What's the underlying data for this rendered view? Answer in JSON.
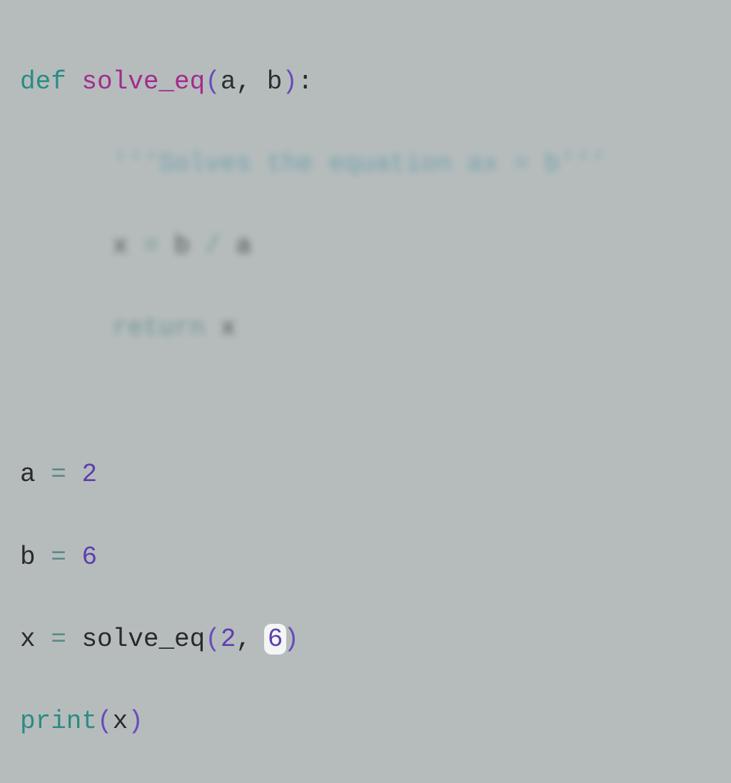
{
  "code": {
    "line1": {
      "def": "def",
      "space1": " ",
      "fn": "solve_eq",
      "lparen": "(",
      "p1": "a",
      "comma": ",",
      "space2": " ",
      "p2": "b",
      "rparen": ")",
      "colon": ":"
    },
    "line2": {
      "indent": "      ",
      "doc": "'''Solves the equation ax = b'''"
    },
    "line3": {
      "indent": "      ",
      "v": "x",
      "sp1": " ",
      "eq": "=",
      "sp2": " ",
      "b": "b",
      "sp3": " ",
      "div": "/",
      "sp4": " ",
      "a": "a"
    },
    "line4": {
      "indent": "      ",
      "ret": "return",
      "sp": " ",
      "x": "x"
    },
    "line6": {
      "a": "a",
      "sp1": " ",
      "eq": "=",
      "sp2": " ",
      "val": "2"
    },
    "line7": {
      "b": "b",
      "sp1": " ",
      "eq": "=",
      "sp2": " ",
      "val": "6"
    },
    "line8": {
      "x": "x",
      "sp1": " ",
      "eq": "=",
      "sp2": " ",
      "fn": "solve_eq",
      "lparen": "(",
      "a1": "2",
      "comma": ",",
      "sp3": " ",
      "a2": "6",
      "rparen": ")"
    },
    "line9": {
      "fn": "print",
      "lparen": "(",
      "arg": "x",
      "rparen": ")"
    }
  }
}
